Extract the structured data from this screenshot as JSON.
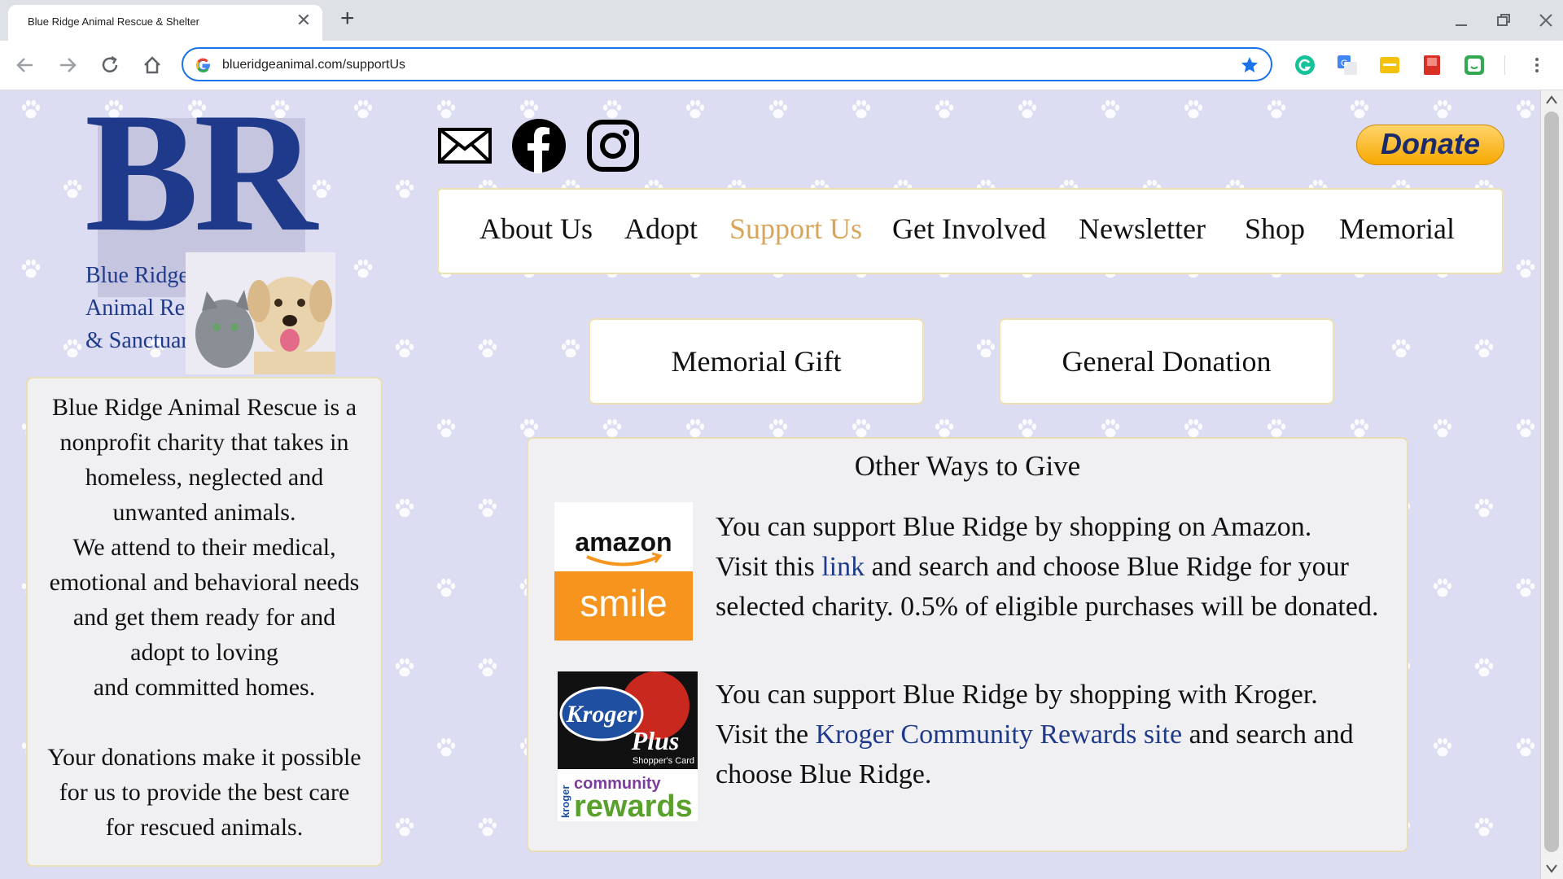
{
  "browser": {
    "tab_title": "Blue Ridge Animal Rescue & Shelter",
    "tab_close": "✕",
    "new_tab": "+",
    "url": "blueridgeanimal.com/supportUs"
  },
  "logo": {
    "letters": "BR",
    "line1": "Blue Ridge",
    "line2": "Animal Rescue",
    "line3": "& Sanctuary"
  },
  "about": {
    "lines1": [
      "Blue Ridge Animal Rescue is a",
      "nonprofit charity that takes in",
      "homeless, neglected and",
      "unwanted animals.",
      "We attend to their medical,",
      "emotional and behavioral needs",
      "and get them ready for and",
      "adopt to loving",
      "and committed homes."
    ],
    "lines2": [
      "Your donations make it possible",
      "for us to provide the best care",
      "for rescued animals."
    ]
  },
  "donate_label": "Donate",
  "nav": {
    "items": [
      "About Us",
      "Adopt",
      "Support Us",
      "Get Involved",
      "Newsletter",
      "Shop",
      "Memorial"
    ],
    "active": "Support Us"
  },
  "actions": {
    "memorial": "Memorial Gift",
    "general": "General Donation"
  },
  "ways": {
    "title": "Other Ways to Give",
    "amazon": {
      "logo_top": "amazon",
      "logo_bottom": "smile",
      "line1": "You can support Blue Ridge by shopping on Amazon.",
      "line2_pre": "Visit this ",
      "line2_link": "link",
      "line2_post": " and search and choose Blue Ridge for your",
      "line3": "selected charity. 0.5% of eligible purchases will be donated."
    },
    "kroger": {
      "logo_brand": "Kroger",
      "logo_plus": "Plus",
      "logo_card": "Shopper's Card",
      "logo_side": "kroger",
      "logo_community": "community",
      "logo_rewards": "rewards",
      "line1": "You can support Blue Ridge by shopping with Kroger.",
      "line2_pre": "Visit the ",
      "line2_link": "Kroger Community Rewards site",
      "line2_post": " and search and",
      "line3": "choose Blue Ridge."
    }
  },
  "colors": {
    "brand_blue": "#1f3a8a",
    "active_nav": "#d8a55a",
    "page_bg": "#dcdcf2",
    "donate_gold": "#f7a800"
  },
  "icons": [
    "envelope-icon",
    "facebook-icon",
    "instagram-icon",
    "back-icon",
    "forward-icon",
    "reload-icon",
    "home-icon",
    "google-icon",
    "star-icon",
    "menu-icon"
  ]
}
